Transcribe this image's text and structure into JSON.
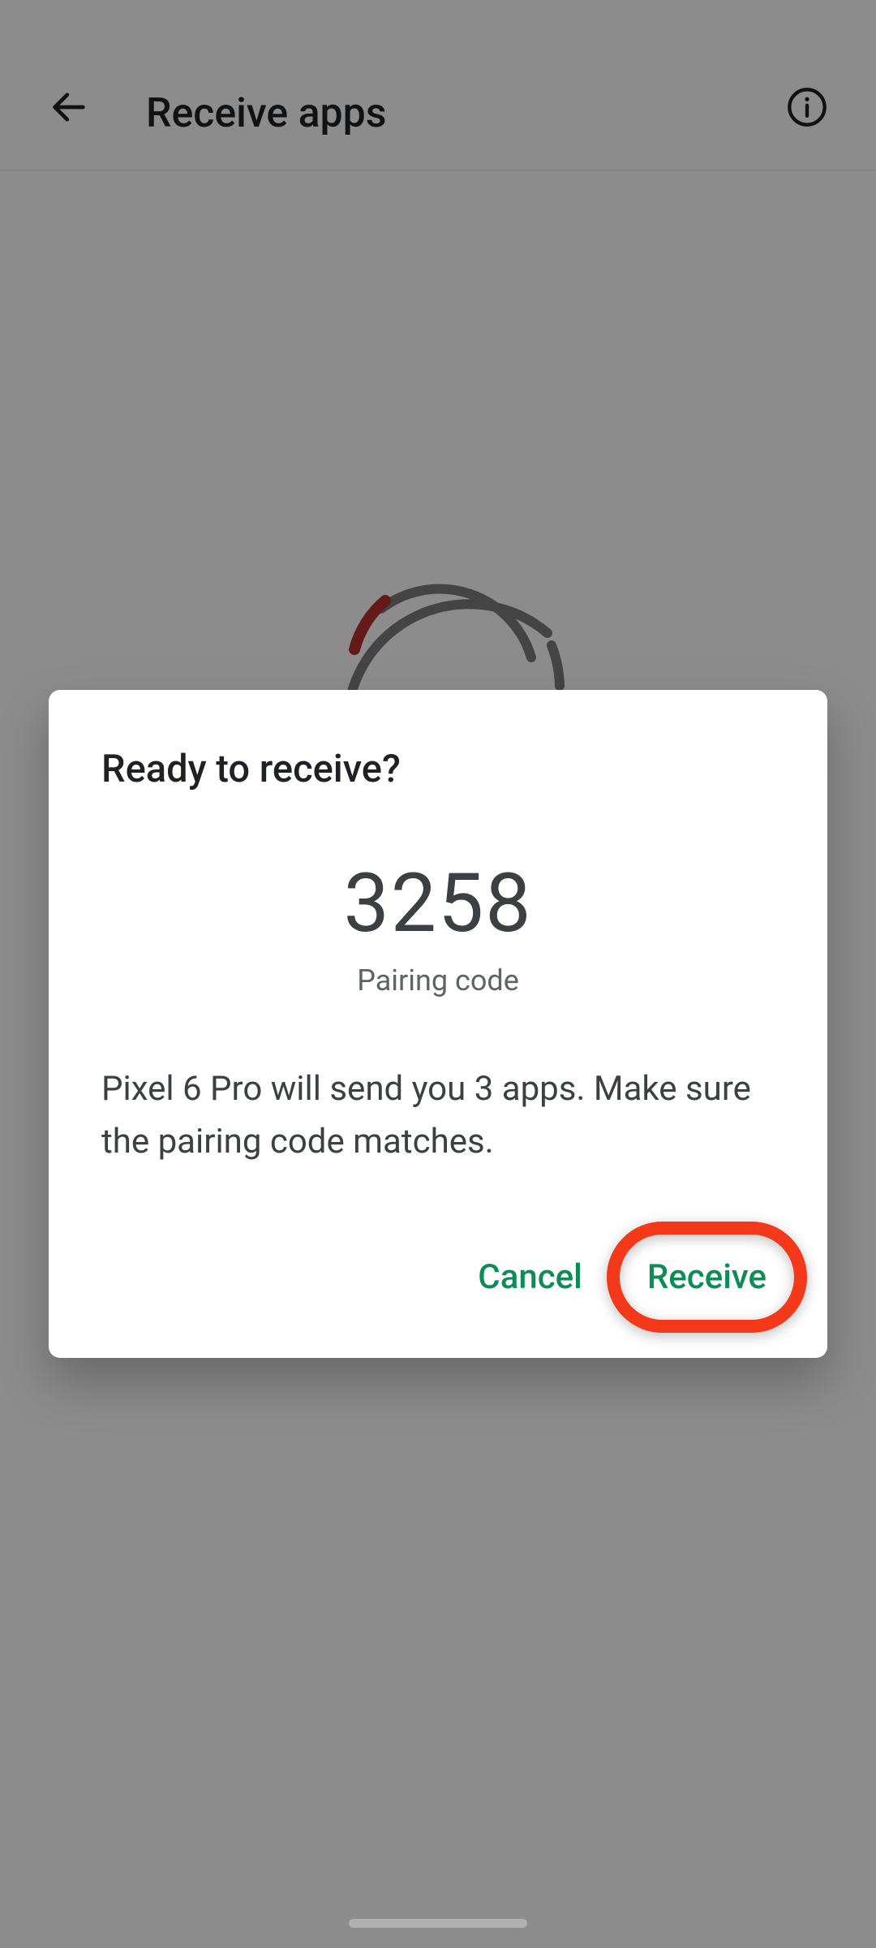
{
  "header": {
    "title": "Receive apps"
  },
  "dialog": {
    "title": "Ready to receive?",
    "pairing_code": "3258",
    "pairing_label": "Pairing code",
    "body": "Pixel 6 Pro will send you 3 apps. Make sure the pairing code matches.",
    "cancel_label": "Cancel",
    "receive_label": "Receive"
  },
  "colors": {
    "accent_green": "#0f8b54",
    "highlight_ring": "#f4381a",
    "spinner_red": "#b83131",
    "spinner_grey": "#7d7d7d"
  }
}
